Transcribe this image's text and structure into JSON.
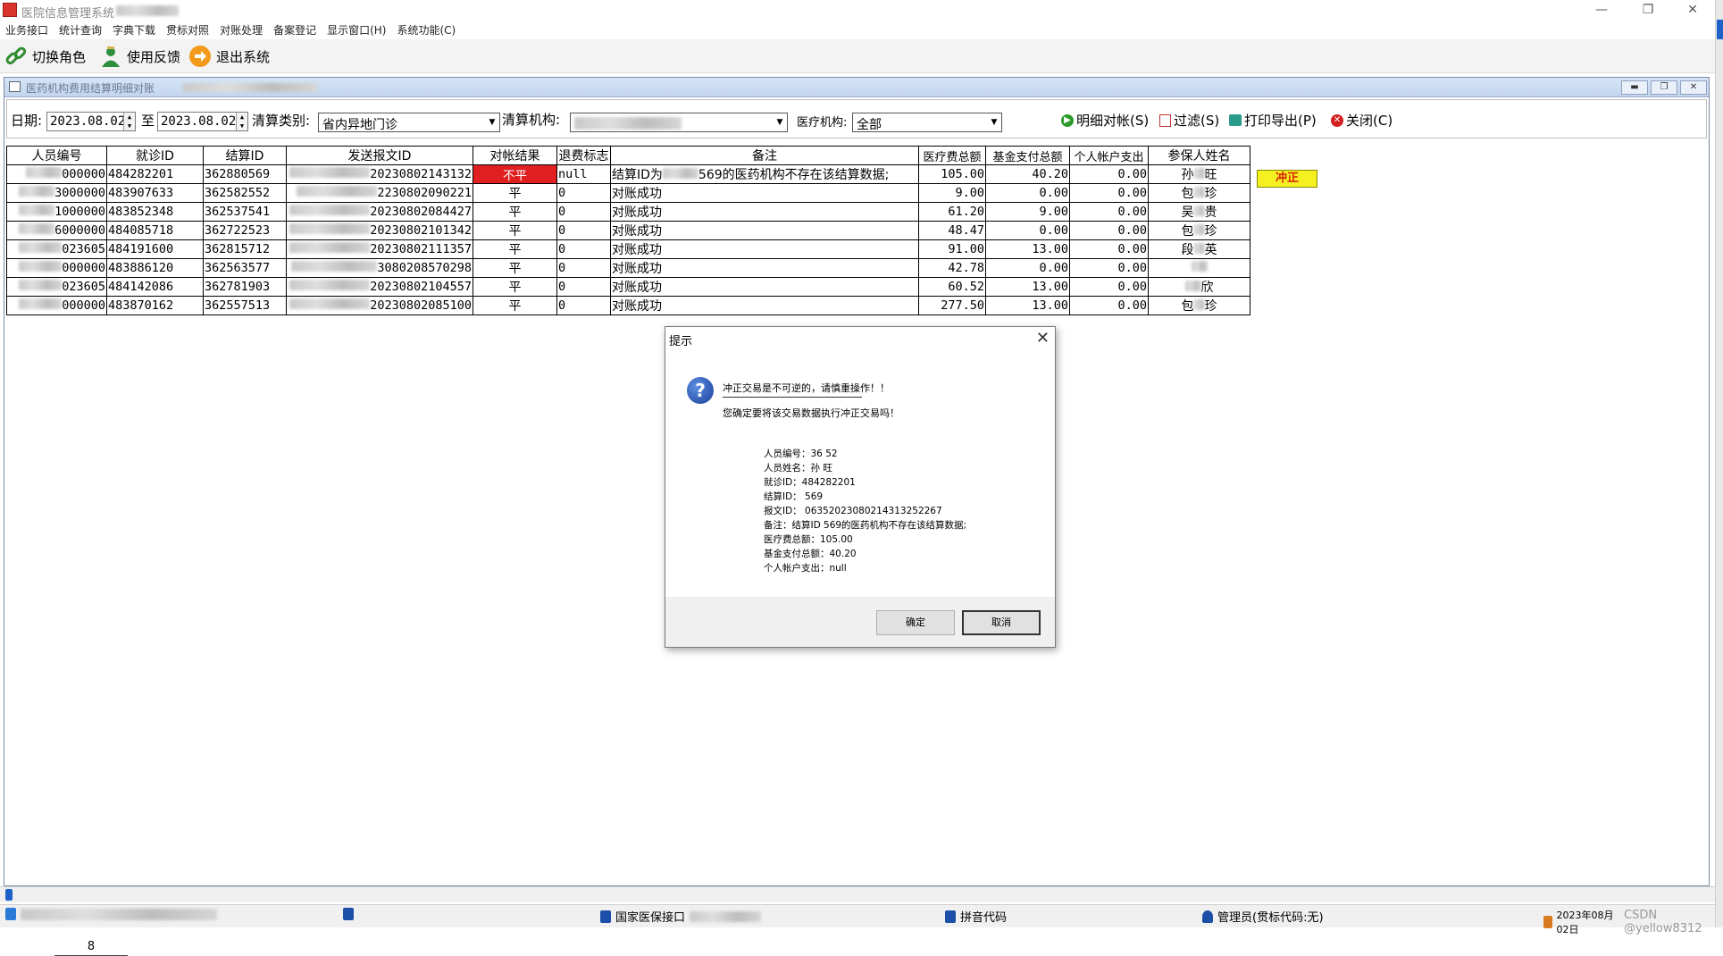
{
  "window": {
    "title": "医院信息管理系统"
  },
  "menu": [
    "业务接口",
    "统计查询",
    "字典下载",
    "贯标对照",
    "对账处理",
    "备案登记",
    "显示窗口(H)",
    "系统功能(C)"
  ],
  "toolbar": {
    "switch_role": "切换角色",
    "feedback": "使用反馈",
    "exit": "退出系统"
  },
  "child": {
    "title": "医药机构费用结算明细对账"
  },
  "filter": {
    "date_label": "日期:",
    "date_from": "2023.08.02",
    "to_label": "至",
    "date_to": "2023.08.02",
    "clear_type_label": "清算类别:",
    "clear_type_value": "省内异地门诊",
    "clear_org_label": "清算机构:",
    "med_org_label": "医疗机构:",
    "med_org_value": "全部",
    "btn_detail": "明细对帐(S)",
    "btn_filter": "过滤(S)",
    "btn_print": "打印导出(P)",
    "btn_close": "关闭(C)"
  },
  "grid": {
    "columns": [
      "人员编号",
      "就诊ID",
      "结算ID",
      "发送报文ID",
      "对帐结果",
      "退费标志",
      "备注",
      "医疗费总额",
      "基金支付总额",
      "个人帐户支出",
      "参保人姓名"
    ],
    "rows": [
      {
        "person_suffix": "000000",
        "visit_id": "484282201",
        "settle_id": "362880569",
        "msg_suffix": "20230802143132",
        "result": "不平",
        "refund": "null",
        "note_prefix": "结算ID为",
        "note_suffix": "569的医药机构不存在该结算数据;",
        "total": "105.00",
        "fund": "40.20",
        "account": "0.00",
        "name_first": "孙",
        "name_last": "旺"
      },
      {
        "person_suffix": "3000000",
        "visit_id": "483907633",
        "settle_id": "362582552",
        "msg_suffix": "2230802090221",
        "result": "平",
        "refund": "0",
        "note": "对账成功",
        "total": "9.00",
        "fund": "0.00",
        "account": "0.00",
        "name_first": "包",
        "name_last": "珍"
      },
      {
        "person_suffix": "1000000",
        "visit_id": "483852348",
        "settle_id": "362537541",
        "msg_suffix": "20230802084427",
        "result": "平",
        "refund": "0",
        "note": "对账成功",
        "total": "61.20",
        "fund": "9.00",
        "account": "0.00",
        "name_first": "吴",
        "name_last": "贵"
      },
      {
        "person_suffix": "6000000",
        "visit_id": "484085718",
        "settle_id": "362722523",
        "msg_suffix": "20230802101342",
        "result": "平",
        "refund": "0",
        "note": "对账成功",
        "total": "48.47",
        "fund": "0.00",
        "account": "0.00",
        "name_first": "包",
        "name_last": "珍"
      },
      {
        "person_suffix": "023605",
        "visit_id": "484191600",
        "settle_id": "362815712",
        "msg_suffix": "20230802111357",
        "result": "平",
        "refund": "0",
        "note": "对账成功",
        "total": "91.00",
        "fund": "13.00",
        "account": "0.00",
        "name_first": "段",
        "name_last": "英"
      },
      {
        "person_suffix": "000000",
        "visit_id": "483886120",
        "settle_id": "362563577",
        "msg_suffix": "3080208570298",
        "result": "平",
        "refund": "0",
        "note": "对账成功",
        "total": "42.78",
        "fund": "0.00",
        "account": "0.00",
        "name_first": "",
        "name_last": ""
      },
      {
        "person_suffix": "023605",
        "visit_id": "484142086",
        "settle_id": "362781903",
        "msg_suffix": "20230802104557",
        "result": "平",
        "refund": "0",
        "note": "对账成功",
        "total": "60.52",
        "fund": "13.00",
        "account": "0.00",
        "name_first": "",
        "name_last": "欣"
      },
      {
        "person_suffix": "000000",
        "visit_id": "483870162",
        "settle_id": "362557513",
        "msg_suffix": "20230802085100",
        "result": "平",
        "refund": "0",
        "note": "对账成功",
        "total": "277.50",
        "fund": "13.00",
        "account": "0.00",
        "name_first": "包",
        "name_last": "珍"
      }
    ],
    "reverse_button": "冲正",
    "row_count": "8"
  },
  "dialog": {
    "title": "提示",
    "line1": "冲正交易是不可逆的，请慎重操作！！",
    "line2": "您确定要将该交易数据执行冲正交易吗！",
    "details": [
      "人员编号：36                         52",
      "人员姓名：孙     旺",
      "就诊ID：484282201",
      "结算ID：          569",
      "报文ID：           06352023080214313252267",
      "备注：结算ID           569的医药机构不存在该结算数据;",
      "医疗费总额：105.00",
      "基金支付总额：40.20",
      "个人帐户支出：null"
    ],
    "ok": "确定",
    "cancel": "取消"
  },
  "status": {
    "national_interface": "国家医保接口",
    "pinyin": "拼音代码",
    "admin": "管理员(贯标代码:无)",
    "date": "2023年08月02日",
    "watermark": "CSDN @yellow8312"
  },
  "colors": {
    "mismatch": "#e02020",
    "reverse_btn": "#f5f020",
    "accent": "#1c62c8"
  }
}
